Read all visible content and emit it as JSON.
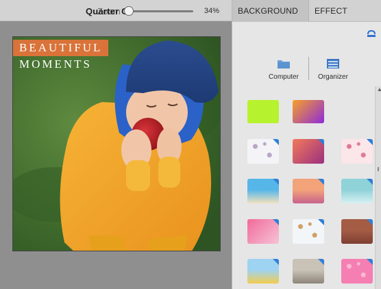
{
  "zoom": {
    "label_a": "Quarter C",
    "label_b": "Zoom",
    "value": "34%",
    "level_percent": 34
  },
  "canvas": {
    "title_line_1": "BEAUTIFUL",
    "title_line_2": "MOMENTS",
    "title_box_color": "#d9733a"
  },
  "panel": {
    "tabs": [
      {
        "label": "BACKGROUND",
        "selected": true
      },
      {
        "label": "EFFECT",
        "selected": false
      }
    ],
    "sources": [
      {
        "label": "Computer",
        "icon": "folder-icon"
      },
      {
        "label": "Organizer",
        "icon": "organizer-icon"
      }
    ],
    "reset_icon": "reset-icon",
    "swatches": [
      {
        "name": "swatch-lime",
        "style": "solid",
        "colors": [
          "#b7f22f",
          "#b7f22f"
        ]
      },
      {
        "name": "swatch-orange-purple-gradient",
        "style": "gradient",
        "colors": [
          "#f7a028",
          "#8e2bd9"
        ]
      },
      {
        "name": "swatch-floral-pattern",
        "style": "pattern",
        "colors": [
          "#f4f4f6",
          "#b7a6c9"
        ]
      },
      {
        "name": "swatch-pink-orange-gradient",
        "style": "gradient",
        "colors": [
          "#f27a5b",
          "#9b2f7f"
        ]
      },
      {
        "name": "swatch-hearts-pink",
        "style": "pattern",
        "colors": [
          "#fbe6ea",
          "#e07a93"
        ]
      },
      {
        "name": "swatch-beach",
        "style": "photo",
        "colors": [
          "#57b6e8",
          "#f1e2be"
        ]
      },
      {
        "name": "swatch-sunset",
        "style": "photo",
        "colors": [
          "#f2a37a",
          "#c7628c"
        ]
      },
      {
        "name": "swatch-city-blue",
        "style": "photo",
        "colors": [
          "#8fd2d8",
          "#d8f0f2"
        ]
      },
      {
        "name": "swatch-pink-blur",
        "style": "gradient",
        "colors": [
          "#f16a9a",
          "#f6c3d5"
        ]
      },
      {
        "name": "swatch-autumn-leaves",
        "style": "pattern",
        "colors": [
          "#f3f6f9",
          "#d1a064"
        ]
      },
      {
        "name": "swatch-brick",
        "style": "photo",
        "colors": [
          "#a45c45",
          "#7e3f32"
        ]
      },
      {
        "name": "swatch-toy-blocks",
        "style": "photo",
        "colors": [
          "#9ed3f1",
          "#f3cc4f"
        ]
      },
      {
        "name": "swatch-wood",
        "style": "photo",
        "colors": [
          "#c9c2b6",
          "#8d8579"
        ]
      },
      {
        "name": "swatch-hearts-fill",
        "style": "pattern",
        "colors": [
          "#f57fb2",
          "#f9b7d3"
        ]
      }
    ]
  }
}
